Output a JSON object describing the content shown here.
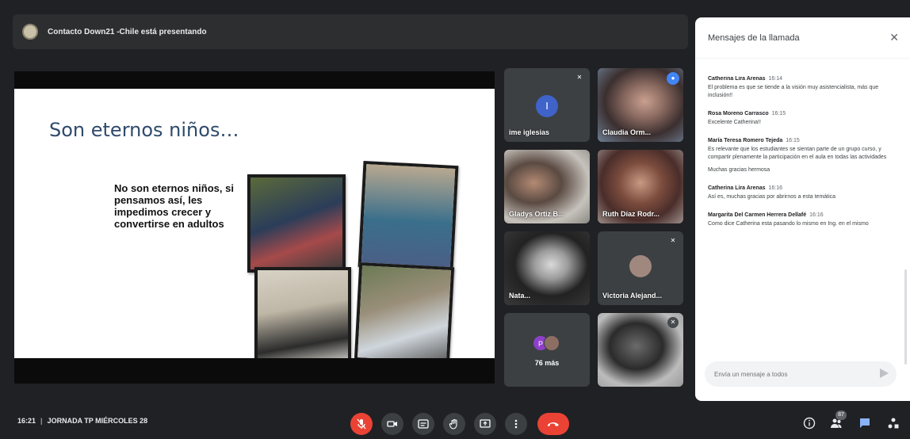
{
  "banner": {
    "presenting_text": "Contacto Down21 -Chile está presentando"
  },
  "slide": {
    "title": "Son eternos niños…",
    "body": "No son eternos niños, si pensamos así, les impedimos crecer y convertirse en adultos"
  },
  "participants": [
    {
      "name": "ime iglesias",
      "initial": "I"
    },
    {
      "name": "Claudia Orm..."
    },
    {
      "name": "Gladys Ortiz B..."
    },
    {
      "name": "Ruth Díaz Rodr..."
    },
    {
      "name": "Nata..."
    },
    {
      "name": "Victoria Alejand..."
    },
    {
      "more_label": "76 más",
      "initial": "P"
    },
    {
      "name": ""
    }
  ],
  "chat": {
    "title": "Mensajes de la llamada",
    "messages": [
      {
        "author": "Catherina Lira Arenas",
        "time": "16:14",
        "text": "El problema es que se tiende a la visión muy asistencialista, más que inclusión!!"
      },
      {
        "author": "Rosa Moreno Carrasco",
        "time": "16:15",
        "text": "Excelente Catherina!!"
      },
      {
        "author": "María Teresa Romero Tejeda",
        "time": "16:15",
        "text": "Es relevante que los estudiantes se sientan parte de un grupo curso, y compartir plenamente la participación en el aula en todas las actividades",
        "extra": "Muchas gracias hermosa"
      },
      {
        "author": "Catherina Lira Arenas",
        "time": "16:16",
        "text": "Así es, muchas gracias por abrirnos a esta temática"
      },
      {
        "author": "Margarita Del Carmen Herrera Dellafé",
        "time": "16:16",
        "text": "Como dice Catherina esta pasando lo mismo en Ing. en el mismo"
      }
    ],
    "input_placeholder": "Envía un mensaje a todos"
  },
  "footer": {
    "time": "16:21",
    "meeting_title": "JORNADA TP MIÉRCOLES 28",
    "participants_count": "87"
  },
  "colors": {
    "background": "#202124",
    "tile": "#3c4043",
    "accent_blue": "#4285f4",
    "danger_red": "#ea4335",
    "slide_title": "#2f4a6c"
  }
}
